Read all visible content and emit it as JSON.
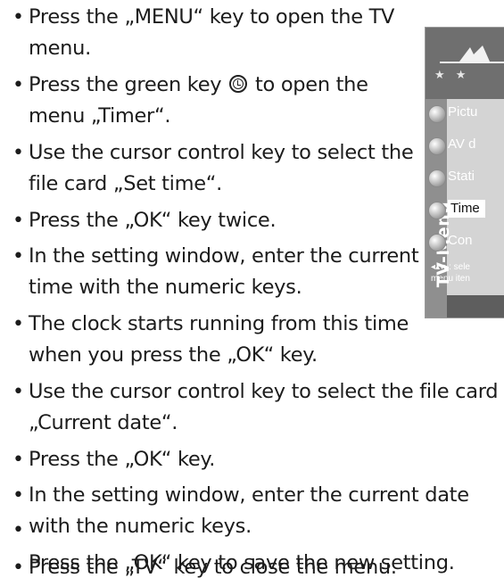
{
  "steps": [
    {
      "lines": [
        "Press the „MENU“ key to open the TV",
        "menu."
      ]
    },
    {
      "lines_pre": "Press the green key",
      "lines_post": "to open the",
      "cont": "menu „Timer“."
    },
    {
      "lines": [
        "Use the cursor control key to select the",
        "file card „Set time“."
      ]
    },
    {
      "lines": [
        "Press the „OK“ key twice."
      ]
    },
    {
      "lines": [
        "In the setting window, enter the current",
        "time with the numeric keys."
      ]
    },
    {
      "lines": [
        "The clock starts running from this time",
        "when you press the „OK“ key."
      ]
    },
    {
      "lines": [
        "Use the cursor control key to select the file card",
        "„Current date“."
      ]
    },
    {
      "lines": [
        "Press the „OK“ key."
      ]
    },
    {
      "lines": [
        "In the setting window, enter the current date",
        "with the numeric keys."
      ]
    },
    {
      "lines": [
        "Press the „OK“ key to save the new setting."
      ]
    },
    {
      "lines": [
        "Press the „TV“ key to close the menu."
      ]
    }
  ],
  "key_icon": "timer-key-icon",
  "tv_menu": {
    "side_label": "TV-Menü",
    "stars": "★ ★",
    "items": [
      "Pictu",
      "AV d",
      "Stati",
      "Time",
      "Con"
    ],
    "selected_index": 3,
    "hint_line1": "◂▴▾▸: sele",
    "hint_line2": "menu iten"
  }
}
